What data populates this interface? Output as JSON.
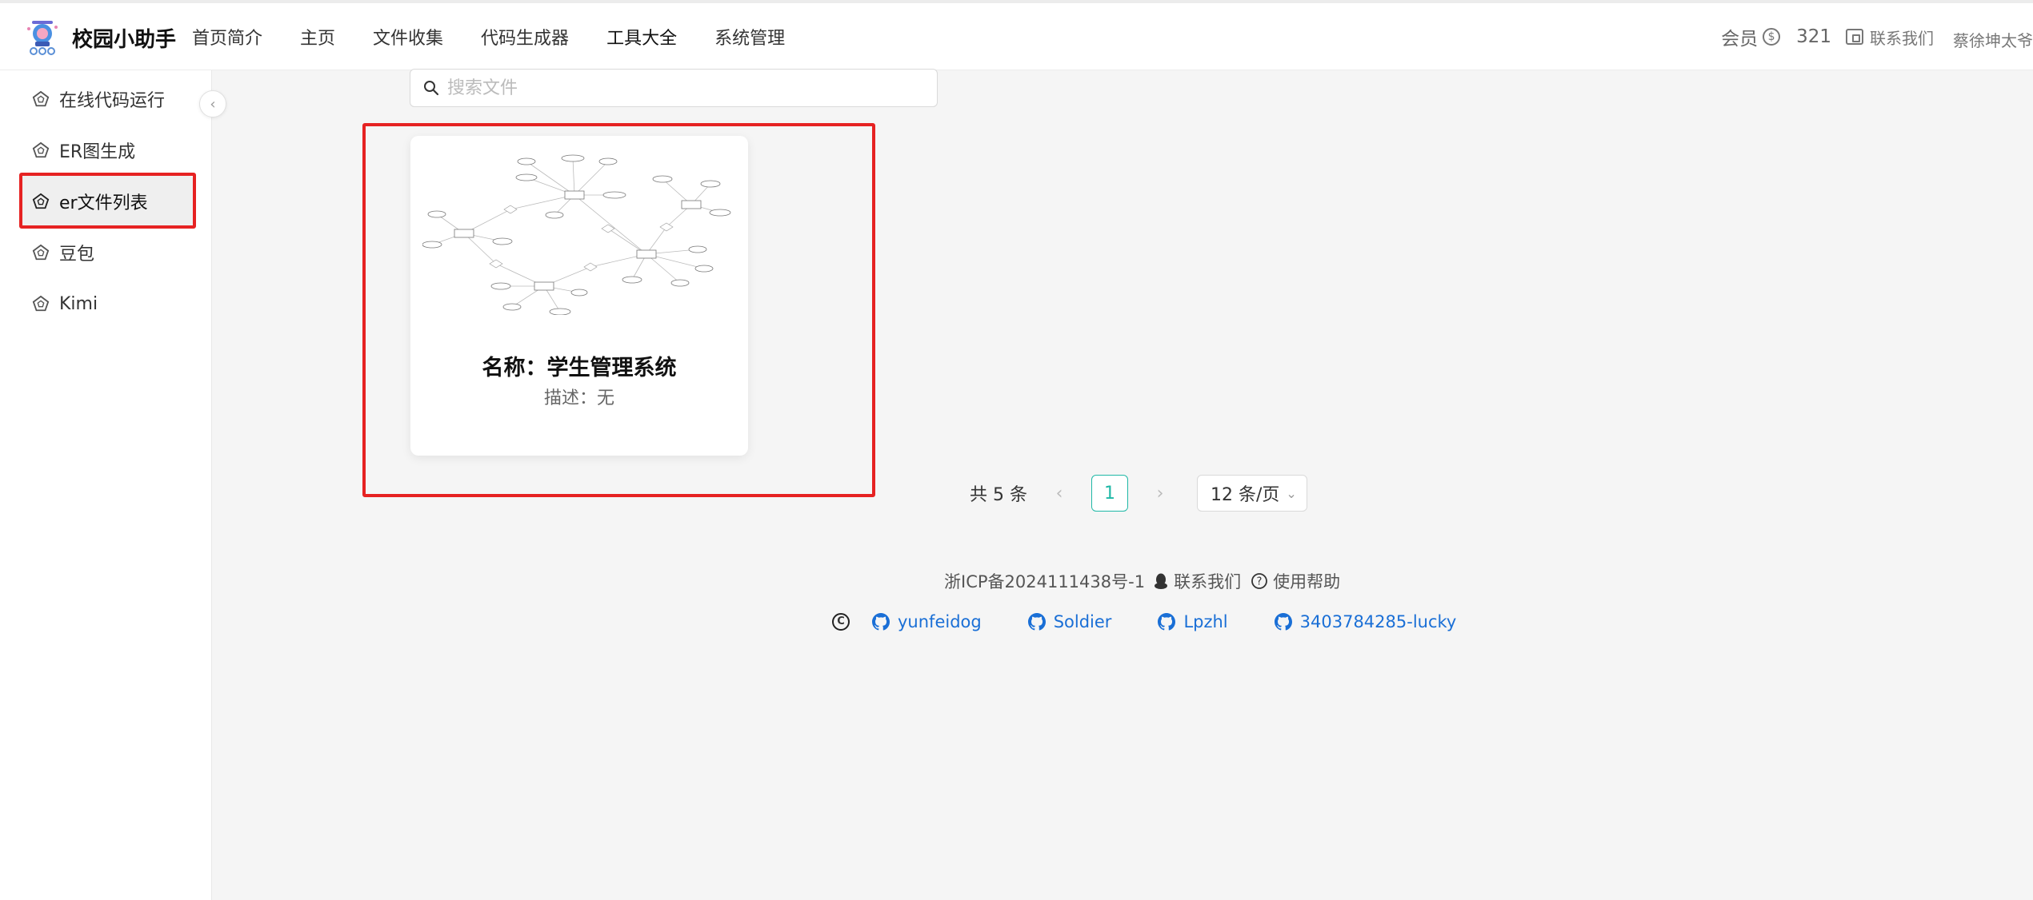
{
  "header": {
    "brand": "校园小助手",
    "nav": [
      "首页简介",
      "主页",
      "文件收集",
      "代码生成器",
      "工具大全",
      "系统管理"
    ],
    "member_label": "会员",
    "points": "321",
    "contact": "联系我们",
    "user": "蔡徐坤太爷"
  },
  "sidebar": {
    "items": [
      {
        "label": "在线代码运行"
      },
      {
        "label": "ER图生成"
      },
      {
        "label": "er文件列表"
      },
      {
        "label": "豆包"
      },
      {
        "label": "Kimi"
      }
    ],
    "active_index": 2
  },
  "search": {
    "placeholder": "搜索文件",
    "value": ""
  },
  "card": {
    "name": "名称：学生管理系统",
    "desc": "描述：无"
  },
  "pagination": {
    "total": "共 5 条",
    "current_page": "1",
    "page_size": "12 条/页"
  },
  "footer": {
    "icp": "浙ICP备2024111438号-1",
    "contact": "联系我们",
    "help": "使用帮助",
    "links": [
      "yunfeidog",
      "Soldier",
      "Lpzhl",
      "3403784285-lucky"
    ]
  },
  "colors": {
    "accent": "#1fb8a6",
    "link": "#1a6fd6",
    "highlight": "#e62222"
  }
}
